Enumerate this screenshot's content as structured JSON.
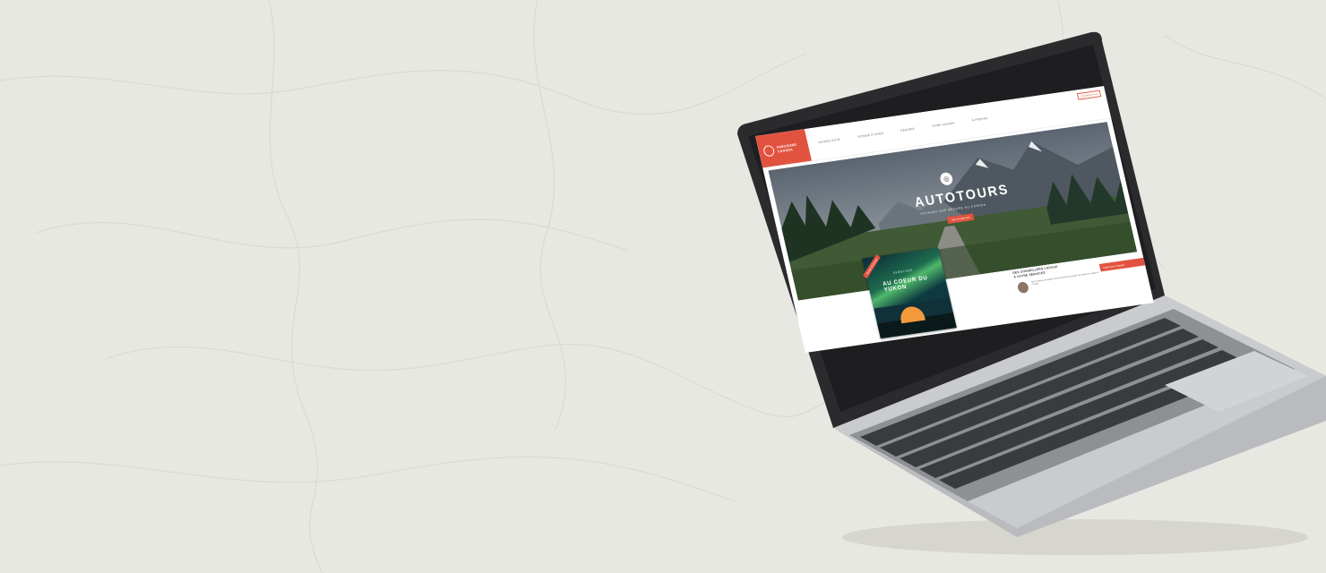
{
  "site": {
    "logo_line1": "PARCOURS",
    "logo_line2": "CANADA",
    "nav": [
      "VOYAGE D'ÉTÉ",
      "VOYAGE D'HIVER",
      "RÉGIONS",
      "VIVRE CANADA",
      "À PROPOS"
    ],
    "contact": "Contactez-nous",
    "hero_title": "AUTOTOURS",
    "hero_subtitle": "VOYAGEZ SUR MESURE AU CANADA",
    "hero_button": "Voir nos parcours",
    "card_kicker": "AVENTURE",
    "card_title": "AU COEUR DU YUKON",
    "card_ribbon": "Voyage de groupe",
    "advisors_title_line1": "DES CONSEILLERS LOCAUX",
    "advisors_title_line2": "À VOTRE SERVICES",
    "advisors_body": "Nous sommes une équipe locale passionnée qui guide vos projets de voyage au Canada.",
    "cta_label": "Parlez avec l'équipe"
  },
  "colors": {
    "background": "#e8e8e2",
    "accent": "#e2533f",
    "laptop_frame": "#2b2b2d",
    "laptop_body": "#a9abae"
  }
}
